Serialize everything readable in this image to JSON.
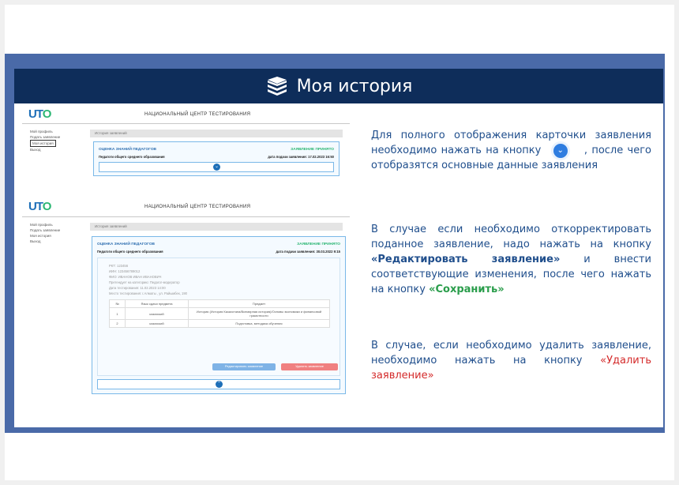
{
  "title": "Моя история",
  "colors": {
    "title_bar": "#0e2d5a",
    "band": "#4a6aa8",
    "text": "#1f4e8c",
    "green": "#2a9d4b",
    "red": "#d42a2a"
  },
  "shot1": {
    "logo": "UTO",
    "header": "НАЦИОНАЛЬНЫЙ ЦЕНТР ТЕСТИРОВАНИЯ",
    "sidebar": [
      "Мой профиль",
      "Подать заявление",
      "Моя история",
      "Выход"
    ],
    "history_header": "История заявлений",
    "card_title": "ОЦЕНКА ЗНАНИЙ ПЕДАГОГОВ",
    "status": "ЗАЯВЛЕНИЕ ПРИНЯТО",
    "subtitle": "Педагоги общего среднего образования",
    "date": "дата подачи заявления: 17.02.2023 16:50"
  },
  "shot2": {
    "logo": "UTO",
    "header": "НАЦИОНАЛЬНЫЙ ЦЕНТР ТЕСТИРОВАНИЯ",
    "sidebar": [
      "Мой профиль",
      "Подать заявление",
      "Моя история",
      "Выход"
    ],
    "history_header": "История заявлений",
    "card_title": "ОЦЕНКА ЗНАНИЙ ПЕДАГОГОВ",
    "status": "ЗАЯВЛЕНИЕ ПРИНЯТО",
    "subtitle": "Педагоги общего среднего образования",
    "date": "дата подачи заявления: 30.03.2022 9:15",
    "info": [
      "РКТ: 123456",
      "ИИН: 123456789012",
      "ФИО: ИВАНОВ ИВАН ИВАНОВИЧ",
      "Претендует на категорию: Педагог-модератор",
      "Дата тестирования: 11.02.2023 14:00",
      "Место тестирования: г.Алматы , ул. Райымбек, 190"
    ],
    "table_headers": [
      "№",
      "Язык сдачи предмета",
      "Предмет"
    ],
    "table_rows": [
      [
        "1",
        "казахский",
        "История (История Казахстана/Всемирная история)/Основы экономики и финансовой грамотности"
      ],
      [
        "2",
        "казахский",
        "Подготовка, методика обучения"
      ]
    ],
    "btn_edit": "Редактировать заявление",
    "btn_delete": "Удалить заявление"
  },
  "texts": {
    "p1_a": "Для полного отображения карточки заявления необходимо нажать на кнопку",
    "p1_b": ", после чего отобразятся основные данные заявления",
    "p2_a": "В случае если необходимо откорректировать поданное заявление, надо нажать на кнопку",
    "p2_edit": "«Редактировать заявление»",
    "p2_b": "и внести соответствующие изменения, после чего нажать на кнопку",
    "p2_save": "«Сохранить»",
    "p3_a": "В случае, если необходимо удалить заявление, необходимо нажать на кнопку",
    "p3_delete": "«Удалить заявление»"
  }
}
